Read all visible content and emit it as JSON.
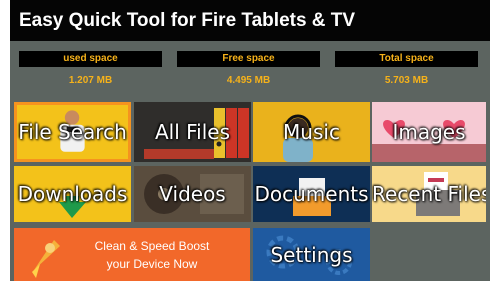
{
  "app": {
    "title": "Easy Quick Tool for Fire Tablets & TV"
  },
  "stats": [
    {
      "label": "used space",
      "value": "1.207 MB"
    },
    {
      "label": "Free space",
      "value": "4.495 MB"
    },
    {
      "label": "Total space",
      "value": "5.703 MB"
    }
  ],
  "tiles": {
    "file_search": "File Search",
    "all_files": "All Files",
    "music": "Music",
    "images": "Images",
    "downloads": "Downloads",
    "videos": "Videos",
    "documents": "Documents",
    "recent_files": "Recent Files",
    "settings": "Settings"
  },
  "promo": {
    "line1": "Clean & Speed Boost",
    "line2": "your Device Now"
  },
  "colors": {
    "background": "#5c6460",
    "title_bar": "#050505",
    "stat_text": "#f6b21a",
    "file_search_border": "#f5931f",
    "promo": "#f2682a",
    "settings": "#1f5aa0",
    "documents": "#0e2f55",
    "downloads_arrow": "#1f9a4a"
  },
  "icons": [
    "person-icon",
    "binders-icon",
    "headphones-icon",
    "hearts-icon",
    "download-arrow-icon",
    "film-reel-icon",
    "document-icon",
    "folder-icon",
    "rocket-icon",
    "gears-icon"
  ]
}
